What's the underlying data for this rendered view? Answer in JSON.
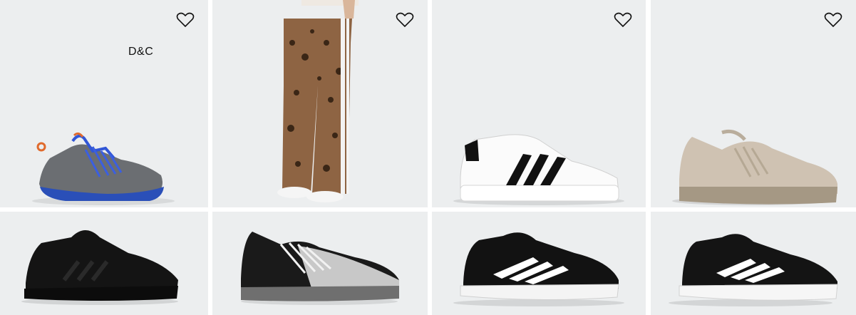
{
  "products": [
    {
      "name": "product-card-1",
      "brand_tag": "D&C",
      "wishlist": "heart-icon",
      "image": "grey-blue-lace-sneaker"
    },
    {
      "name": "product-card-2",
      "wishlist": "heart-icon",
      "image": "leopard-print-track-pants"
    },
    {
      "name": "product-card-3",
      "wishlist": "heart-icon",
      "image": "white-black-stripe-court-sneaker"
    },
    {
      "name": "product-card-4",
      "wishlist": "heart-icon",
      "image": "beige-knit-running-shoe"
    },
    {
      "name": "product-card-5",
      "image": "all-black-running-shoe"
    },
    {
      "name": "product-card-6",
      "image": "black-white-knit-lace-sneaker"
    },
    {
      "name": "product-card-7",
      "image": "black-white-stripe-runner"
    },
    {
      "name": "product-card-8",
      "image": "black-white-stripe-runner-2"
    }
  ],
  "colors": {
    "card_bg": "#eceeef",
    "page_bg": "#ffffff"
  }
}
